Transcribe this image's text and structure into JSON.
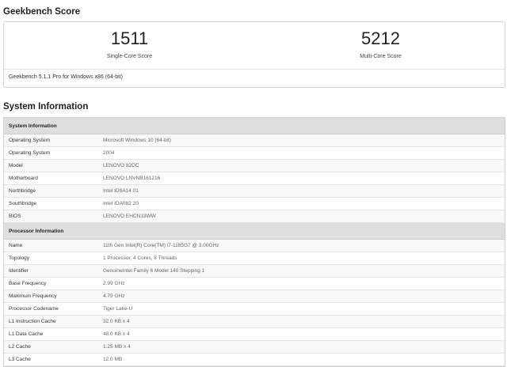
{
  "score_section": {
    "title": "Geekbench Score",
    "single_core": {
      "value": "1511",
      "label": "Single-Core Score"
    },
    "multi_core": {
      "value": "5212",
      "label": "Multi-Core Score"
    },
    "footer": "Geekbench 5.1.1 Pro for Windows x86 (64-bit)"
  },
  "system_section": {
    "title": "System Information",
    "groups": [
      {
        "header": "System Information",
        "rows": [
          {
            "key": "Operating System",
            "value": "Microsoft Windows 10 (64-bit)"
          },
          {
            "key": "Operating System",
            "value": "2004"
          },
          {
            "key": "Model",
            "value": "LENOVO 82DC"
          },
          {
            "key": "Motherboard",
            "value": "LENOVO LNVNB161216"
          },
          {
            "key": "Northbridge",
            "value": "Intel ID9A14 01"
          },
          {
            "key": "Southbridge",
            "value": "Intel IDA082 20"
          },
          {
            "key": "BIOS",
            "value": "LENOVO EHCN33WW"
          }
        ]
      },
      {
        "header": "Processor Information",
        "rows": [
          {
            "key": "Name",
            "value": "11th Gen Intel(R) Core(TM) i7-1185G7 @ 3.00GHz"
          },
          {
            "key": "Topology",
            "value": "1 Processor, 4 Cores, 8 Threads"
          },
          {
            "key": "Identifier",
            "value": "GenuineIntel Family 6 Model 140 Stepping 1"
          },
          {
            "key": "Base Frequency",
            "value": "2.99 GHz"
          },
          {
            "key": "Maximum Frequency",
            "value": "4.79 GHz"
          },
          {
            "key": "Processor Codename",
            "value": "Tiger Lake-U"
          },
          {
            "key": "L1 Instruction Cache",
            "value": "32.0 KB x 4"
          },
          {
            "key": "L1 Data Cache",
            "value": "48.0 KB x 4"
          },
          {
            "key": "L2 Cache",
            "value": "1.25 MB x 4"
          },
          {
            "key": "L3 Cache",
            "value": "12.0 MB"
          }
        ]
      }
    ]
  }
}
